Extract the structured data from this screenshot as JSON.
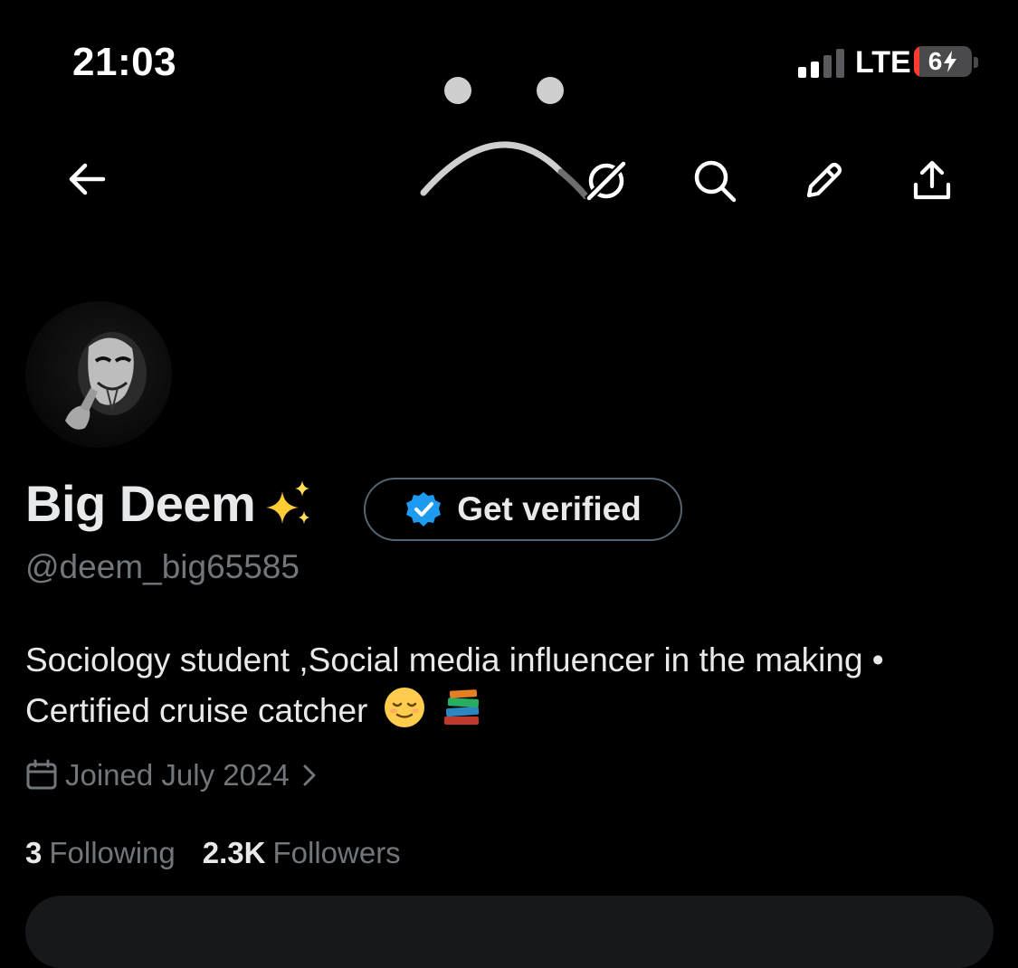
{
  "status_bar": {
    "time": "21:03",
    "network": "LTE",
    "battery_label": "6",
    "battery_level_percent": 6,
    "signal_bars_active": 2,
    "signal_bars_total": 4
  },
  "colors": {
    "background": "#000000",
    "text_primary": "#e7e9ea",
    "text_secondary": "#71767b",
    "verified_blue": "#1d9bf0",
    "button_border": "#536471",
    "battery_low": "#ff3b30"
  },
  "nav": {
    "back_icon": "arrow-left-icon",
    "icons": [
      "grok-icon",
      "search-icon",
      "edit-pencil-icon",
      "share-upload-icon"
    ]
  },
  "profile": {
    "display_name": "Big Deem",
    "name_emoji": "sparkles",
    "handle": "@deem_big65585",
    "get_verified_label": "Get verified",
    "bio_line_1": "Sociology student ,Social media influencer in the making •",
    "bio_line_2": "Certified cruise catcher",
    "bio_emojis": [
      "relieved-face",
      "books"
    ],
    "joined": "Joined July 2024",
    "following_count": "3",
    "following_label": "Following",
    "followers_count": "2.3K",
    "followers_label": "Followers"
  }
}
